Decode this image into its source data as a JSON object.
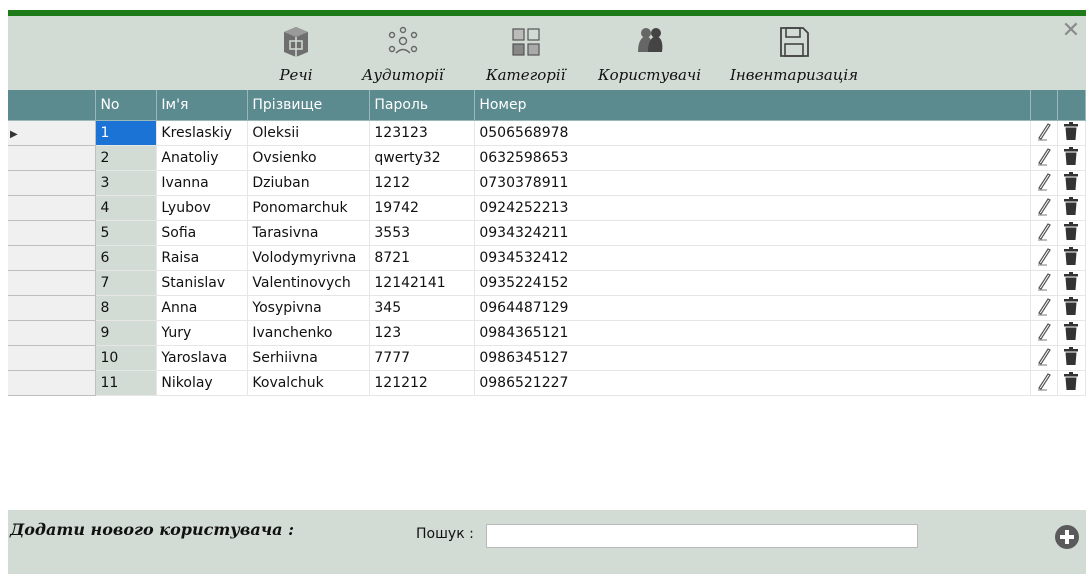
{
  "window": {
    "close_symbol": "✕"
  },
  "toolbar": {
    "items": [
      {
        "label": "Речі",
        "icon": "box-icon"
      },
      {
        "label": "Аудиторії",
        "icon": "network-icon"
      },
      {
        "label": "Категорії",
        "icon": "category-grid-icon"
      },
      {
        "label": "Користувачі",
        "icon": "users-icon"
      },
      {
        "label": "Інвентаризація",
        "icon": "save-icon"
      }
    ]
  },
  "table": {
    "headers": {
      "no": "No",
      "name": "Ім'я",
      "surname": "Прізвище",
      "password": "Пароль",
      "number": "Номер"
    },
    "rows": [
      {
        "no": "1",
        "name": "Kreslaskiy",
        "surname": "Oleksii",
        "password": "123123",
        "number": "0506568978"
      },
      {
        "no": "2",
        "name": "Anatoliy",
        "surname": "Ovsienko",
        "password": "qwerty32",
        "number": "0632598653"
      },
      {
        "no": "3",
        "name": "Ivanna",
        "surname": "Dziuban",
        "password": "1212",
        "number": "0730378911"
      },
      {
        "no": "4",
        "name": "Lyubov",
        "surname": "Ponomarchuk",
        "password": "19742",
        "number": "0924252213"
      },
      {
        "no": "5",
        "name": "Sofia",
        "surname": "Tarasivna",
        "password": "3553",
        "number": "0934324211"
      },
      {
        "no": "6",
        "name": "Raisa",
        "surname": "Volodymyrivna",
        "password": "8721",
        "number": "0934532412"
      },
      {
        "no": "7",
        "name": "Stanislav",
        "surname": "Valentinovych",
        "password": "12142141",
        "number": "0935224152"
      },
      {
        "no": "8",
        "name": "Anna",
        "surname": "Yosypivna",
        "password": "345",
        "number": "0964487129"
      },
      {
        "no": "9",
        "name": "Yury",
        "surname": "Ivanchenko",
        "password": "123",
        "number": "0984365121"
      },
      {
        "no": "10",
        "name": "Yaroslava",
        "surname": "Serhiivna",
        "password": "7777",
        "number": "0986345127"
      },
      {
        "no": "11",
        "name": "Nikolay",
        "surname": "Kovalchuk",
        "password": "121212",
        "number": "0986521227"
      }
    ]
  },
  "footer": {
    "add_label": "Додати нового користувача :",
    "search_label": "Пошук :",
    "search_value": ""
  },
  "colors": {
    "header": "#5b8a8f",
    "background": "#d3dcd4",
    "topbar": "#1f7a1a",
    "selected": "#1b73d6"
  }
}
